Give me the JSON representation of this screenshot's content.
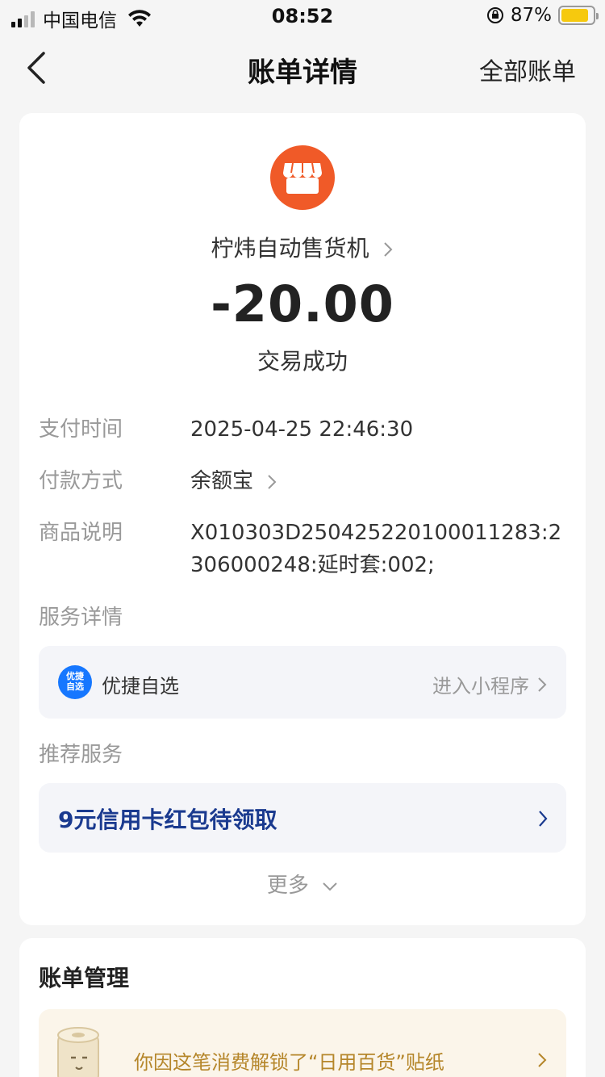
{
  "status_bar": {
    "carrier": "中国电信",
    "time": "08:52",
    "battery_pct": "87%",
    "battery_level": 0.87,
    "battery_color": "#f6c90e"
  },
  "nav": {
    "back_icon": "chevron-left-icon",
    "title": "账单详情",
    "right_label": "全部账单"
  },
  "transaction": {
    "merchant_icon": "store-icon",
    "merchant_name": "柠炜自动售货机",
    "amount": "-20.00",
    "status": "交易成功",
    "accent_color": "#f05a28"
  },
  "details": [
    {
      "label": "支付时间",
      "value": "2025-04-25 22:46:30"
    },
    {
      "label": "付款方式",
      "value": "余额宝"
    },
    {
      "label": "商品说明",
      "value": "X010303D250425220100011283:2306000248:延时套:002;"
    }
  ],
  "service": {
    "section_label": "服务详情",
    "icon_text": "优捷自选",
    "name": "优捷自选",
    "action": "进入小程序"
  },
  "recommend": {
    "section_label": "推荐服务",
    "promo_text": "9元信用卡红包待领取",
    "promo_color": "#1a3a8f"
  },
  "more_label": "更多",
  "manage": {
    "title": "账单管理",
    "sticker_text": "你因这笔消费解锁了“日用百货”贴纸"
  }
}
